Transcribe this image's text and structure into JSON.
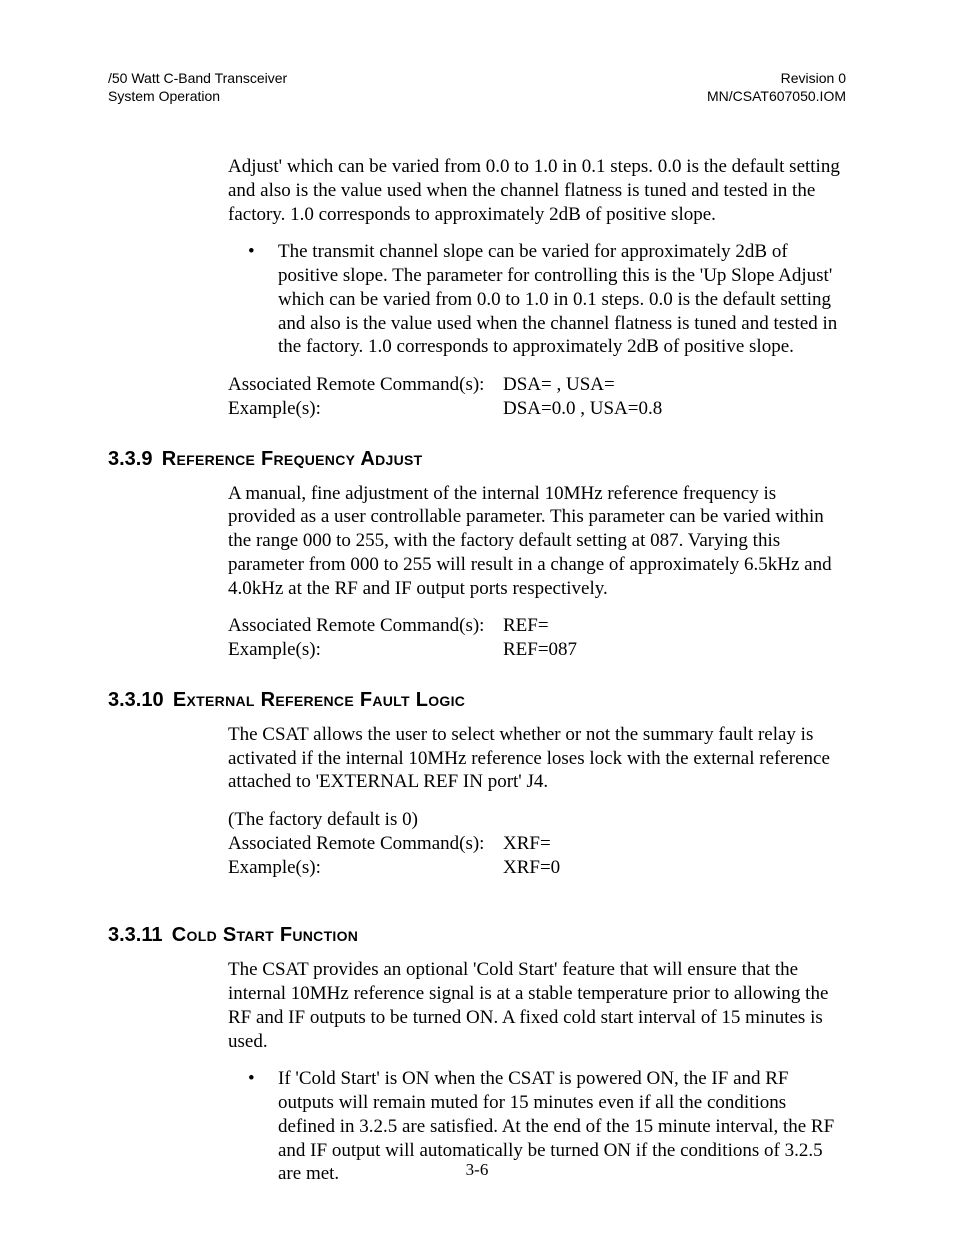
{
  "header": {
    "left1": "/50 Watt C-Band Transceiver",
    "left2": "System Operation",
    "right1": "Revision 0",
    "right2": "MN/CSAT607050.IOM"
  },
  "intro": {
    "para1": "Adjust' which can be varied from 0.0 to 1.0 in 0.1 steps. 0.0 is the default setting and also is the value used when the channel flatness is tuned and tested in the factory. 1.0 corresponds to approximately 2dB of positive slope.",
    "bullet1": "The transmit channel slope can be varied for approximately 2dB of positive slope. The parameter for controlling this is the 'Up Slope Adjust' which can be varied from 0.0 to 1.0 in 0.1 steps. 0.0 is the default setting and also is the value used when the channel flatness is tuned and tested in the factory. 1.0 corresponds to approximately 2dB of positive slope.",
    "kv": {
      "cmd_label": "Associated Remote Command(s):",
      "cmd_val": "DSA= , USA=",
      "ex_label": "Example(s):",
      "ex_val": "DSA=0.0 , USA=0.8"
    }
  },
  "sec339": {
    "num": "3.3.9",
    "title": "Reference Frequency Adjust",
    "para": "A manual, fine adjustment of the internal 10MHz reference frequency is provided as a user controllable parameter. This parameter can be varied within the range 000 to 255, with the factory default setting at 087. Varying this parameter from 000 to 255 will result in a change of approximately 6.5kHz and 4.0kHz at the RF and IF output ports respectively.",
    "kv": {
      "cmd_label": "Associated Remote Command(s):",
      "cmd_val": "REF=",
      "ex_label": "Example(s):",
      "ex_val": "REF=087"
    }
  },
  "sec3310": {
    "num": "3.3.10",
    "title": "External Reference Fault Logic",
    "para": "The CSAT allows the user to select whether or not the summary fault relay is activated if the internal 10MHz reference loses lock with the external reference attached to 'EXTERNAL REF IN port' J4.",
    "note": "(The factory default is 0)",
    "kv": {
      "cmd_label": "Associated Remote Command(s):",
      "cmd_val": "XRF=",
      "ex_label": "Example(s):",
      "ex_val": "XRF=0"
    }
  },
  "sec3311": {
    "num": "3.3.11",
    "title": "Cold Start Function",
    "para": "The CSAT provides an optional 'Cold Start' feature that will ensure that the internal 10MHz reference signal is at a stable temperature prior to allowing the RF and IF outputs to be turned ON. A fixed cold start interval of 15 minutes is used.",
    "bullet1": "If 'Cold Start' is ON when the CSAT is powered ON, the IF and RF outputs will remain muted for 15 minutes even if all the conditions defined in 3.2.5 are satisfied. At the end of the 15 minute interval, the RF and IF output will automatically be turned ON if the conditions of 3.2.5 are met."
  },
  "page_number": "3-6"
}
